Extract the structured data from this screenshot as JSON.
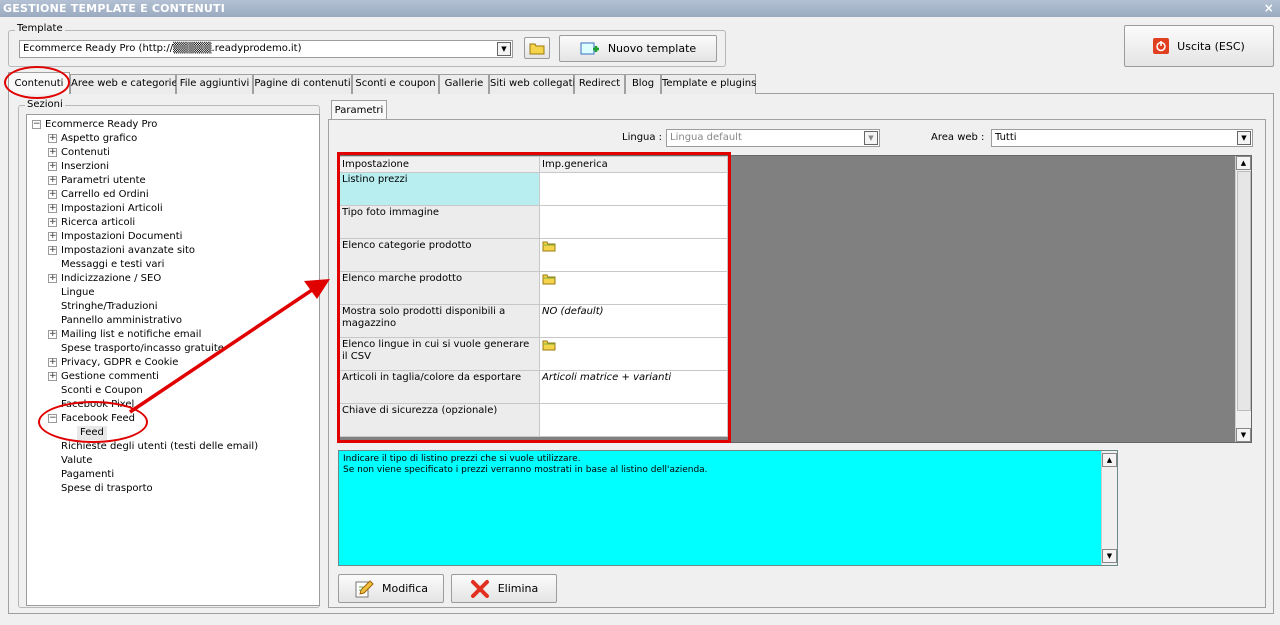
{
  "window": {
    "title": "GESTIONE TEMPLATE E CONTENUTI",
    "close_glyph": "×"
  },
  "template": {
    "group_label": "Template",
    "selected": "Ecommerce Ready Pro (http://▒▒▒▒▒.readyprodemo.it)",
    "new_button": "Nuovo template"
  },
  "exit_button": "Uscita (ESC)",
  "tabs": [
    {
      "label": "Contenuti",
      "active": true
    },
    {
      "label": "Aree web e categorie"
    },
    {
      "label": "File aggiuntivi"
    },
    {
      "label": "Pagine di contenuti"
    },
    {
      "label": "Sconti e coupon"
    },
    {
      "label": "Gallerie"
    },
    {
      "label": "Siti web collegati"
    },
    {
      "label": "Redirect"
    },
    {
      "label": "Blog"
    },
    {
      "label": "Template e plugins"
    }
  ],
  "sections": {
    "label": "Sezioni",
    "tree": [
      {
        "label": "Ecommerce Ready Pro",
        "level": 0,
        "exp": "−"
      },
      {
        "label": "Aspetto grafico",
        "level": 1,
        "exp": "+"
      },
      {
        "label": "Contenuti",
        "level": 1,
        "exp": "+"
      },
      {
        "label": "Inserzioni",
        "level": 1,
        "exp": "+"
      },
      {
        "label": "Parametri utente",
        "level": 1,
        "exp": "+"
      },
      {
        "label": "Carrello ed Ordini",
        "level": 1,
        "exp": "+"
      },
      {
        "label": "Impostazioni Articoli",
        "level": 1,
        "exp": "+"
      },
      {
        "label": "Ricerca articoli",
        "level": 1,
        "exp": "+"
      },
      {
        "label": "Impostazioni Documenti",
        "level": 1,
        "exp": "+"
      },
      {
        "label": "Impostazioni avanzate sito",
        "level": 1,
        "exp": "+"
      },
      {
        "label": "Messaggi e testi vari",
        "level": 1,
        "exp": ""
      },
      {
        "label": "Indicizzazione / SEO",
        "level": 1,
        "exp": "+"
      },
      {
        "label": "Lingue",
        "level": 1,
        "exp": ""
      },
      {
        "label": "Stringhe/Traduzioni",
        "level": 1,
        "exp": ""
      },
      {
        "label": "Pannello amministrativo",
        "level": 1,
        "exp": ""
      },
      {
        "label": "Mailing list e notifiche email",
        "level": 1,
        "exp": "+"
      },
      {
        "label": "Spese trasporto/incasso gratuite",
        "level": 1,
        "exp": ""
      },
      {
        "label": "Privacy, GDPR e Cookie",
        "level": 1,
        "exp": "+"
      },
      {
        "label": "Gestione commenti",
        "level": 1,
        "exp": "+"
      },
      {
        "label": "Sconti e Coupon",
        "level": 1,
        "exp": ""
      },
      {
        "label": "Facebook Pixel",
        "level": 1,
        "exp": ""
      },
      {
        "label": "Facebook Feed",
        "level": 1,
        "exp": "−"
      },
      {
        "label": "Feed",
        "level": 2,
        "exp": "",
        "selected": true
      },
      {
        "label": "Richieste degli utenti (testi delle email)",
        "level": 1,
        "exp": ""
      },
      {
        "label": "Valute",
        "level": 1,
        "exp": ""
      },
      {
        "label": "Pagamenti",
        "level": 1,
        "exp": ""
      },
      {
        "label": "Spese di trasporto",
        "level": 1,
        "exp": ""
      }
    ]
  },
  "params": {
    "tab_label": "Parametri",
    "lingua_label": "Lingua :",
    "lingua_value": "Lingua default",
    "area_label": "Area web :",
    "area_value": "Tutti",
    "col_impostazione": "Impostazione",
    "col_generica": "Imp.generica",
    "rows": [
      {
        "label": "Listino prezzi",
        "value": "",
        "icon": false,
        "selected": true
      },
      {
        "label": "Tipo foto immagine",
        "value": "",
        "icon": false
      },
      {
        "label": "Elenco categorie prodotto",
        "value": "",
        "icon": true
      },
      {
        "label": "Elenco marche prodotto",
        "value": "",
        "icon": true
      },
      {
        "label": "Mostra solo prodotti disponibili a magazzino",
        "value": "NO (default)",
        "icon": false
      },
      {
        "label": "Elenco lingue in cui si vuole generare il CSV",
        "value": "",
        "icon": true
      },
      {
        "label": "Articoli in taglia/colore da esportare",
        "value": "Articoli matrice + varianti",
        "icon": false
      },
      {
        "label": "Chiave di sicurezza (opzionale)",
        "value": "",
        "icon": false
      }
    ]
  },
  "description": {
    "line1": "Indicare il tipo di listino prezzi che si vuole utilizzare.",
    "line2": "Se non viene specificato i prezzi verranno mostrati in base al listino dell'azienda."
  },
  "buttons": {
    "modifica": "Modifica",
    "elimina": "Elimina"
  },
  "colors": {
    "annotation_red": "#e00000",
    "desc_bg": "#00ffff",
    "selected_row": "#b8eef0"
  }
}
